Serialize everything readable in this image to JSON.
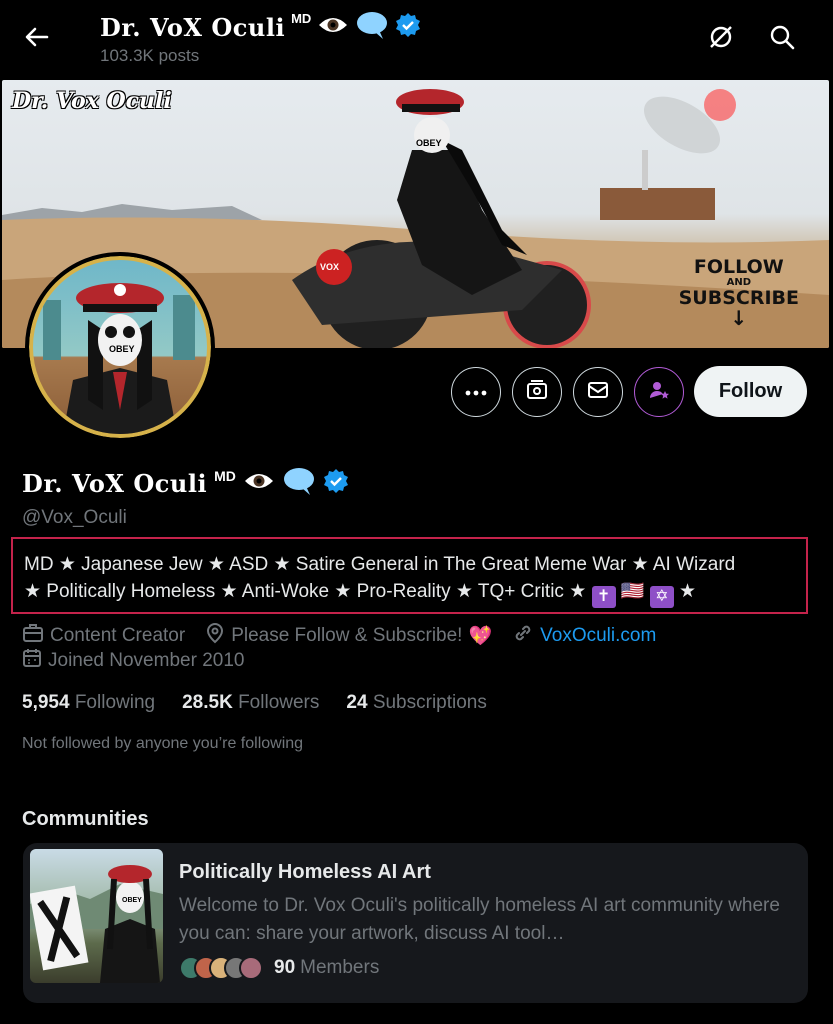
{
  "header": {
    "display_name": "Dr. VoX Oculi",
    "superscript": "MD",
    "posts_count": "103.3K posts",
    "icons": [
      "back-arrow-icon",
      "grok-slash-icon",
      "search-icon"
    ]
  },
  "banner": {
    "watermark": "Dr. Vox Oculi",
    "mask_text": "OBEY",
    "bike_text": "VOX",
    "follow_text": "FOLLOW",
    "and_text": "AND",
    "subscribe_text": "SUBSCRIBE",
    "arrow": "↓"
  },
  "avatar": {
    "mask_text": "OBEY"
  },
  "actions": {
    "follow_label": "Follow",
    "icons": [
      "more-icon",
      "subscribe-icon",
      "message-icon",
      "notify-icon"
    ]
  },
  "profile": {
    "display_name": "Dr. VoX Oculi",
    "superscript": "MD",
    "eye_emoji": "👁",
    "speech_emoji": "💬",
    "verified_color": "#1d9bf0",
    "handle": "@Vox_Oculi",
    "bio_line1": "MD ★ Japanese Jew ★ ASD ★ Satire General in The Great Meme War ★ AI Wizard",
    "bio_line2_prefix": "★ Politically Homeless ★ Anti-Woke ★ Pro-Reality ★ TQ+ Critic ★",
    "bio_cross": "✝",
    "bio_flag": "🇺🇸",
    "bio_star_of_david": "✡",
    "bio_line2_suffix": "★",
    "category": "Content Creator",
    "location": "Please Follow & Subscribe!",
    "location_emoji": "💖",
    "website": "VoxOculi.com",
    "joined": "Joined November 2010"
  },
  "stats": {
    "following_count": "5,954",
    "following_label": "Following",
    "followers_count": "28.5K",
    "followers_label": "Followers",
    "subscriptions_count": "24",
    "subscriptions_label": "Subscriptions"
  },
  "not_followed": "Not followed by anyone you’re following",
  "communities": {
    "section_title": "Communities",
    "card": {
      "name": "Politically Homeless AI Art",
      "description": "Welcome to Dr. Vox Oculi's politically homeless AI art community where you can: share your artwork, discuss AI tool…",
      "member_count": "90",
      "member_label": "Members",
      "thumb_mask_text": "OBEY"
    }
  },
  "colors": {
    "background": "#000000",
    "text_primary": "#e7e9ea",
    "text_secondary": "#71767b",
    "link": "#1d9bf0",
    "bio_highlight_border": "#c4234b",
    "subscribe_ring": "#b15bd6"
  }
}
